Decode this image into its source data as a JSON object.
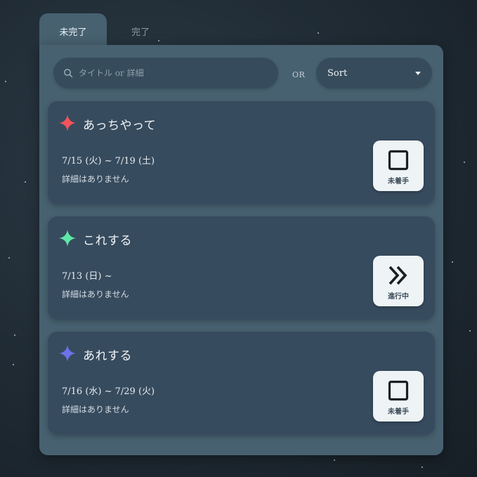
{
  "tabs": [
    {
      "label": "未完了",
      "active": true
    },
    {
      "label": "完了",
      "active": false
    }
  ],
  "toolbar": {
    "search_placeholder": "タイトル or 詳細",
    "search_value": "",
    "or_label": "OR",
    "sort_label": "Sort"
  },
  "tasks": [
    {
      "title": "あっちやって",
      "date": "7/15 (火) ~ 7/19 (土)",
      "detail": "詳細はありません",
      "star_color": "#f2545b",
      "status_label": "未着手",
      "status_icon": "empty-square-icon"
    },
    {
      "title": "これする",
      "date": "7/13 (日) ~",
      "detail": "詳細はありません",
      "star_color": "#5ee8a8",
      "status_label": "進行中",
      "status_icon": "double-chevron-right-icon"
    },
    {
      "title": "あれする",
      "date": "7/16 (水) ~ 7/29 (火)",
      "detail": "詳細はありません",
      "star_color": "#6d73e6",
      "status_label": "未着手",
      "status_icon": "empty-square-icon"
    }
  ],
  "colors": {
    "panel": "#476170",
    "card": "#374b5e",
    "status_button": "#eef3f6"
  }
}
